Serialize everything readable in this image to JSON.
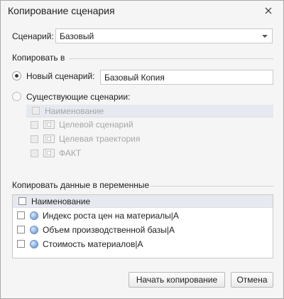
{
  "dialog": {
    "title": "Копирование сценария"
  },
  "scenario": {
    "label": "Сценарий:",
    "value": "Базовый"
  },
  "copy_to": {
    "section_label": "Копировать в",
    "new_scenario": {
      "label": "Новый сценарий:",
      "selected": true,
      "name_value": "Базовый Копия"
    },
    "existing": {
      "label": "Существующие сценарии:",
      "selected": false,
      "column_header": "Наименование",
      "items": [
        {
          "label": "Целевой сценарий",
          "checked": false
        },
        {
          "label": "Целевая траектория",
          "checked": false
        },
        {
          "label": "ФАКТ",
          "checked": false
        }
      ]
    }
  },
  "variables": {
    "section_label": "Копировать данные в переменные",
    "column_header": "Наименование",
    "items": [
      {
        "label": "Индекс роста цен на материалы|A",
        "checked": false
      },
      {
        "label": "Объем производственной базы|A",
        "checked": false
      },
      {
        "label": "Стоимость материалов|A",
        "checked": false
      }
    ]
  },
  "buttons": {
    "start": "Начать копирование",
    "cancel": "Отмена"
  },
  "icons": {
    "close": "close-icon",
    "dropdown": "chevron-down-icon",
    "scenario_item": "film-icon",
    "variable_item": "globe-icon"
  }
}
